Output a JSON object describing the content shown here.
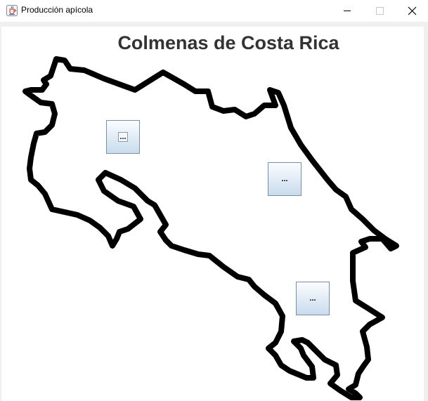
{
  "window": {
    "title": "Producción apícola",
    "icons": {
      "app": "java-cup-icon",
      "minimize": "minimize-icon",
      "maximize": "maximize-icon",
      "close": "close-icon"
    }
  },
  "map": {
    "title": "Colmenas de Costa Rica",
    "outline_color": "#000000"
  },
  "hives": [
    {
      "label": "..."
    },
    {
      "label": "..."
    },
    {
      "label": "..."
    }
  ]
}
